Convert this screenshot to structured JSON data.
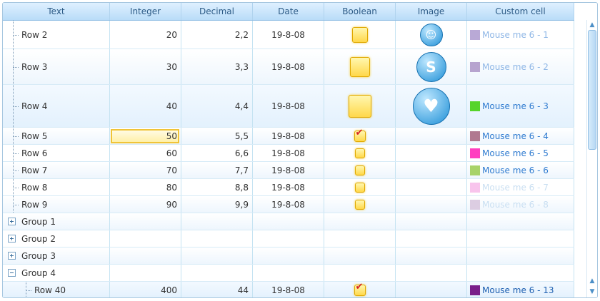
{
  "columns": [
    "Text",
    "Integer",
    "Decimal",
    "Date",
    "Boolean",
    "Image",
    "Custom cell"
  ],
  "rows": [
    {
      "text": "Row 2",
      "integer": "20",
      "decimal": "2,2",
      "date": "19-8-08",
      "checked": false,
      "image": "skype-heart-small",
      "custom": "Mouse me 6 - 1",
      "color": "#b9a9d6",
      "custom_color": "#8fb7e6"
    },
    {
      "text": "Row 3",
      "integer": "30",
      "decimal": "3,3",
      "date": "19-8-08",
      "checked": false,
      "image": "skype-logo-medium",
      "custom": "Mouse me 6 - 2",
      "color": "#b7a4cf",
      "custom_color": "#8fb7e6"
    },
    {
      "text": "Row 4",
      "integer": "40",
      "decimal": "4,4",
      "date": "19-8-08",
      "checked": false,
      "image": "skype-callme-large",
      "custom": "Mouse me 6 - 3",
      "color": "#56d42a",
      "custom_color": "#2f7bd0"
    },
    {
      "text": "Row 5",
      "integer": "50",
      "decimal": "5,5",
      "date": "19-8-08",
      "checked": true,
      "image": "",
      "custom": "Mouse me 6 - 4",
      "color": "#b07990",
      "custom_color": "#2f7bd0"
    },
    {
      "text": "Row 6",
      "integer": "60",
      "decimal": "6,6",
      "date": "19-8-08",
      "checked": false,
      "image": "",
      "custom": "Mouse me 6 - 5",
      "color": "#ff3ec0",
      "custom_color": "#2f7bd0"
    },
    {
      "text": "Row 7",
      "integer": "70",
      "decimal": "7,7",
      "date": "19-8-08",
      "checked": false,
      "image": "",
      "custom": "Mouse me 6 - 6",
      "color": "#a8d36a",
      "custom_color": "#2f7bd0"
    },
    {
      "text": "Row 8",
      "integer": "80",
      "decimal": "8,8",
      "date": "19-8-08",
      "checked": false,
      "image": "",
      "custom": "Mouse me 6 - 7",
      "color": "#f8c4ec",
      "custom_color": "#c9dff2"
    },
    {
      "text": "Row 9",
      "integer": "90",
      "decimal": "9,9",
      "date": "19-8-08",
      "checked": false,
      "image": "",
      "custom": "Mouse me 6 - 8",
      "color": "#dccde2",
      "custom_color": "#c9dff2"
    }
  ],
  "groups": [
    {
      "label": "Group 1",
      "expanded": false
    },
    {
      "label": "Group 2",
      "expanded": false
    },
    {
      "label": "Group 3",
      "expanded": false
    },
    {
      "label": "Group 4",
      "expanded": true
    }
  ],
  "group_row": {
    "text": "Row 40",
    "integer": "400",
    "decimal": "44",
    "date": "19-8-08",
    "checked": true,
    "custom": "Mouse me 6 - 13",
    "color": "#7a1f8a",
    "custom_color": "#1d5fb0"
  },
  "editing": {
    "row": "Row 5",
    "column": "Integer",
    "value": "50"
  },
  "scrollbar": {
    "up_icon": "arrow-up-icon",
    "down_icon": "arrow-down-icon"
  }
}
